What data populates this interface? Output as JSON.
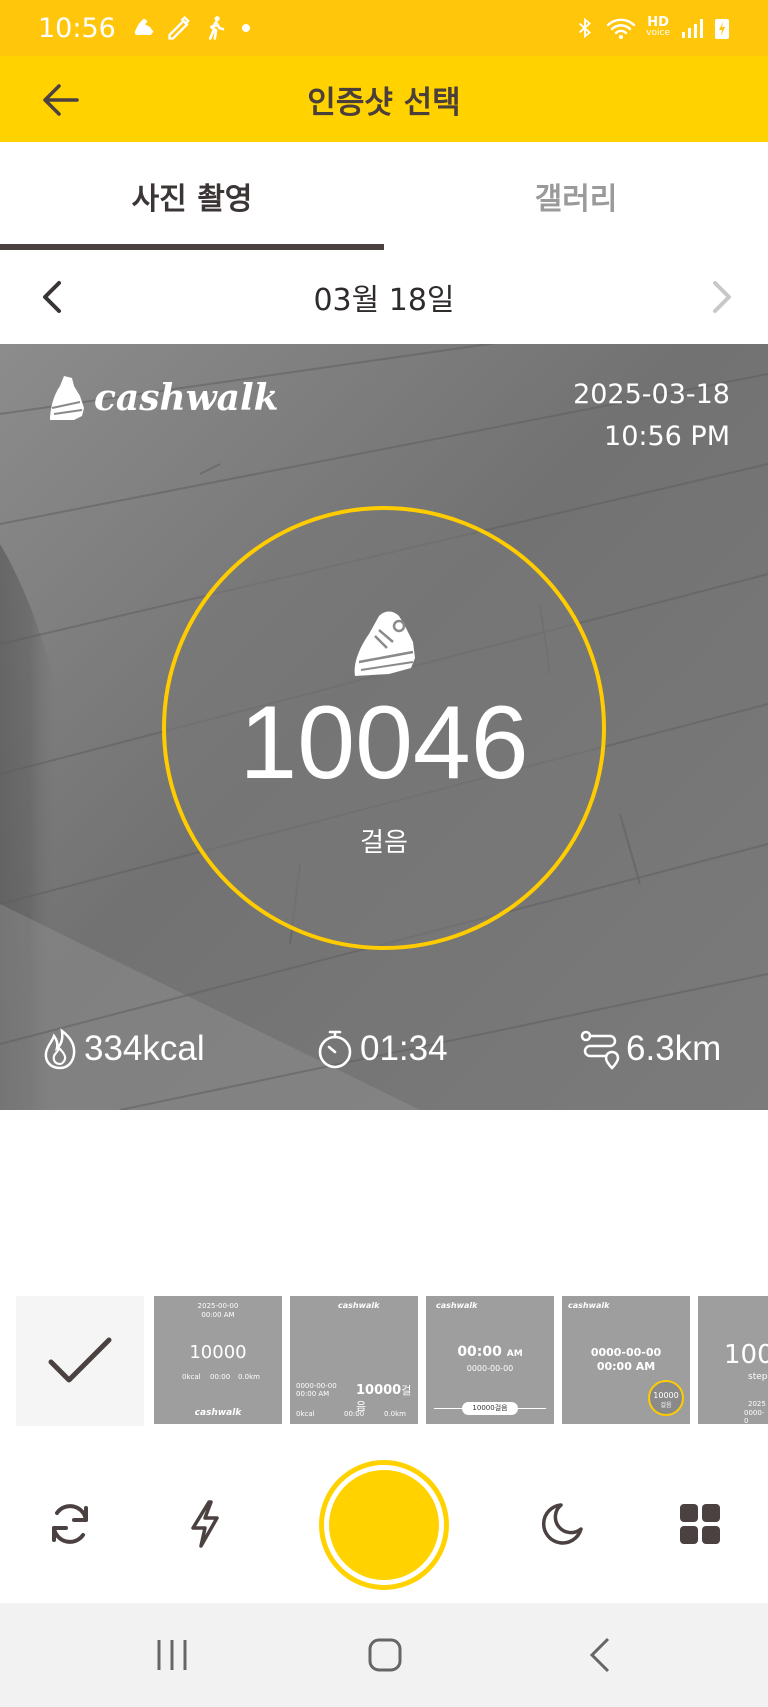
{
  "status_bar": {
    "time": "10:56",
    "hd_label": "HD",
    "voice_label": "voice"
  },
  "app_bar": {
    "title": "인증샷 선택"
  },
  "tabs": [
    {
      "label": "사진 촬영",
      "active": true
    },
    {
      "label": "갤러리",
      "active": false
    }
  ],
  "date_nav": {
    "label": "03월 18일"
  },
  "preview": {
    "brand": "cashwalk",
    "date": "2025-03-18",
    "time": "10:56 PM",
    "steps": "10046",
    "steps_unit": "걸음",
    "calories": "334kcal",
    "duration": "01:34",
    "distance": "6.3km"
  },
  "filters": {
    "t1": {
      "date": "2025-00-00",
      "time": "00:00 AM",
      "steps": "10000",
      "kcal": "0kcal",
      "dur": "00:00",
      "dist": "0.0km",
      "brand": "cashwalk"
    },
    "t2": {
      "brand": "cashwalk",
      "date": "0000-00-00",
      "time": "00:00 AM",
      "steps": "10000",
      "unit": "걸음",
      "kcal": "0kcal",
      "dur": "00:00",
      "dist": "0.0km"
    },
    "t3": {
      "brand": "cashwalk",
      "time": "00:00",
      "ampm": "AM",
      "date": "0000-00-00",
      "pill": "10000걸음"
    },
    "t4": {
      "brand": "cashwalk",
      "date": "0000-00-00",
      "time": "00:00 AM",
      "steps": "10000",
      "unit": "걸음"
    },
    "t5": {
      "steps": "100",
      "unit": "step",
      "date": "2025",
      "dist": "0000-0"
    }
  },
  "colors": {
    "accent": "#FFD200",
    "status": "#FFC60B",
    "text_dark": "#4b4141"
  }
}
